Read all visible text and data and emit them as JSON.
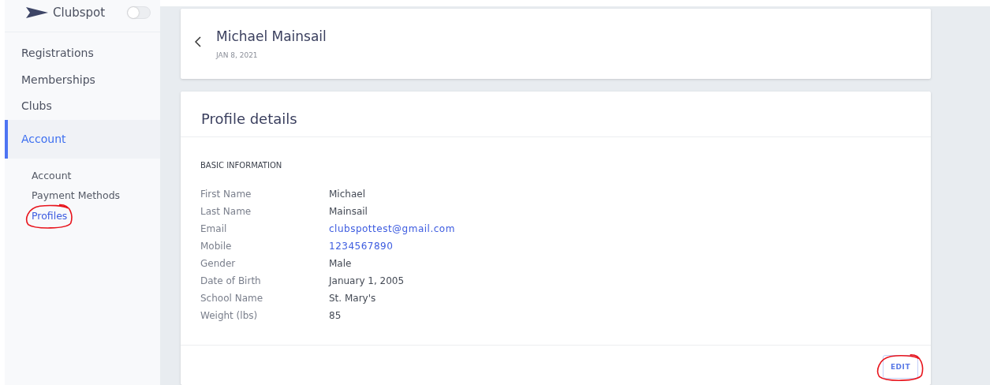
{
  "sidebar": {
    "brand": "Clubspot",
    "toggle": {
      "on": false
    },
    "items": [
      {
        "label": "Registrations",
        "selected": false
      },
      {
        "label": "Memberships",
        "selected": false
      },
      {
        "label": "Clubs",
        "selected": false
      },
      {
        "label": "Account",
        "selected": true
      }
    ],
    "subitems": [
      {
        "label": "Account",
        "selected": false,
        "circled": false
      },
      {
        "label": "Payment Methods",
        "selected": false,
        "circled": false
      },
      {
        "label": "Profiles",
        "selected": true,
        "circled": true
      }
    ]
  },
  "header": {
    "name": "Michael Mainsail",
    "date": "JAN 8, 2021"
  },
  "profile": {
    "title": "Profile details",
    "section": "BASIC INFORMATION",
    "fields": [
      {
        "label": "First Name",
        "value": "Michael",
        "kind": "text"
      },
      {
        "label": "Last Name",
        "value": "Mainsail",
        "kind": "text"
      },
      {
        "label": "Email",
        "value": "clubspottest@gmail.com",
        "kind": "link"
      },
      {
        "label": "Mobile",
        "value": "1234567890",
        "kind": "link"
      },
      {
        "label": "Gender",
        "value": "Male",
        "kind": "text"
      },
      {
        "label": "Date of Birth",
        "value": "January 1, 2005",
        "kind": "text"
      },
      {
        "label": "School Name",
        "value": "St. Mary's",
        "kind": "text"
      },
      {
        "label": "Weight (lbs)",
        "value": "85",
        "kind": "text"
      }
    ],
    "edit_button": {
      "label": "EDIT",
      "circled": true
    }
  }
}
